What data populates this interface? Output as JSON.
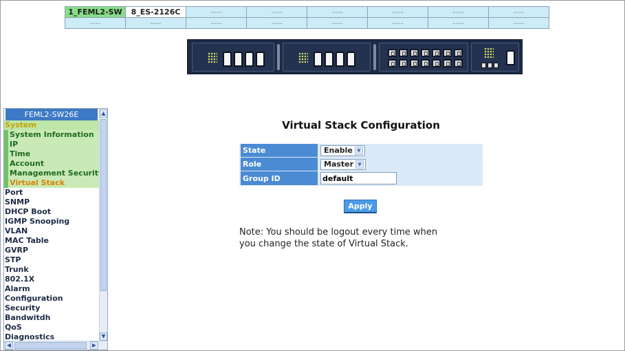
{
  "stack_table": {
    "row1": [
      "1_FEML2-SW",
      "8_ES-2126C",
      "----",
      "----",
      "----",
      "----",
      "----",
      "----"
    ],
    "row2": [
      "----",
      "----",
      "----",
      "----",
      "----",
      "----",
      "----",
      "----"
    ]
  },
  "sidebar": {
    "title": "FEML2-SW26E",
    "items": [
      {
        "label": "System"
      },
      {
        "label": "System Information"
      },
      {
        "label": "IP"
      },
      {
        "label": "Time"
      },
      {
        "label": "Account"
      },
      {
        "label": "Management Security"
      },
      {
        "label": "Virtual Stack"
      },
      {
        "label": "Port"
      },
      {
        "label": "SNMP"
      },
      {
        "label": "DHCP Boot"
      },
      {
        "label": "IGMP Snooping"
      },
      {
        "label": "VLAN"
      },
      {
        "label": "MAC Table"
      },
      {
        "label": "GVRP"
      },
      {
        "label": "STP"
      },
      {
        "label": "Trunk"
      },
      {
        "label": "802.1X"
      },
      {
        "label": "Alarm"
      },
      {
        "label": "Configuration"
      },
      {
        "label": "Security"
      },
      {
        "label": "Bandwitdh"
      },
      {
        "label": "QoS"
      },
      {
        "label": "Diagnostics"
      }
    ]
  },
  "main": {
    "title": "Virtual Stack Configuration",
    "fields": {
      "state": {
        "label": "State",
        "value": "Enable"
      },
      "role": {
        "label": "Role",
        "value": "Master"
      },
      "group_id": {
        "label": "Group ID",
        "value": "default"
      }
    },
    "apply_label": "Apply",
    "note_line1": "Note: You should be logout every time when",
    "note_line2": "you change the state of Virtual Stack."
  },
  "colors": {
    "header_blue": "#4a8bd4",
    "selected_green": "#88dd88",
    "menu_highlight": "#d88200"
  }
}
